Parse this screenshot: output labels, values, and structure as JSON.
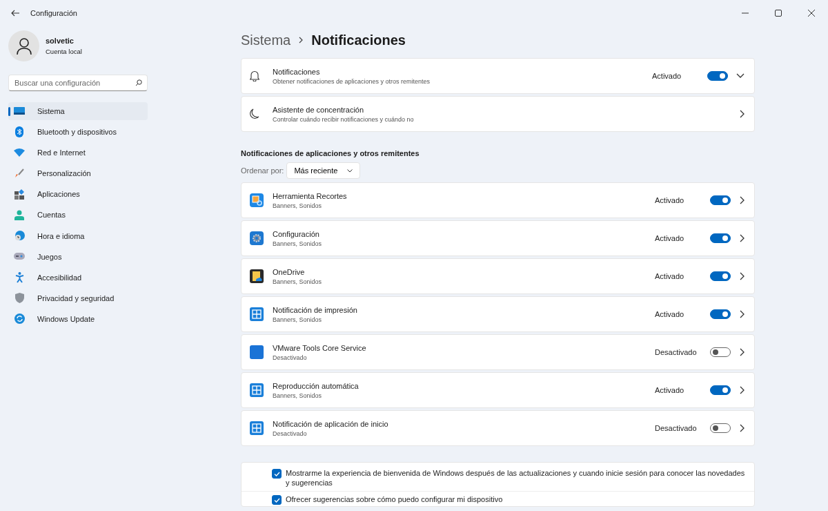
{
  "window": {
    "title": "Configuración"
  },
  "user": {
    "name": "solvetic",
    "account": "Cuenta local"
  },
  "search": {
    "placeholder": "Buscar una configuración"
  },
  "sidebar": {
    "items": [
      {
        "label": "Sistema",
        "kind": "system",
        "selected": true
      },
      {
        "label": "Bluetooth y dispositivos",
        "kind": "bluetooth",
        "selected": false
      },
      {
        "label": "Red e Internet",
        "kind": "network",
        "selected": false
      },
      {
        "label": "Personalización",
        "kind": "brush",
        "selected": false
      },
      {
        "label": "Aplicaciones",
        "kind": "apps",
        "selected": false
      },
      {
        "label": "Cuentas",
        "kind": "accounts",
        "selected": false
      },
      {
        "label": "Hora e idioma",
        "kind": "time",
        "selected": false
      },
      {
        "label": "Juegos",
        "kind": "games",
        "selected": false
      },
      {
        "label": "Accesibilidad",
        "kind": "accessibility",
        "selected": false
      },
      {
        "label": "Privacidad y seguridad",
        "kind": "privacy",
        "selected": false
      },
      {
        "label": "Windows Update",
        "kind": "update",
        "selected": false
      }
    ]
  },
  "breadcrumb": {
    "parent": "Sistema",
    "current": "Notificaciones"
  },
  "cards": [
    {
      "kind": "toggle",
      "title": "Notificaciones",
      "subtitle": "Obtener notificaciones de aplicaciones y otros remitentes",
      "state_label": "Activado",
      "on": true,
      "expanded": false
    },
    {
      "kind": "link",
      "title": "Asistente de concentración",
      "subtitle": "Controlar cuándo recibir notificaciones y cuándo no"
    }
  ],
  "section_title": "Notificaciones de aplicaciones y otros remitentes",
  "sort": {
    "label": "Ordenar por:",
    "value": "Más reciente"
  },
  "apps": [
    {
      "name": "Herramienta Recortes",
      "detail": "Banners, Sonidos",
      "state_label": "Activado",
      "on": true,
      "kind": "snip"
    },
    {
      "name": "Configuración",
      "detail": "Banners, Sonidos",
      "state_label": "Activado",
      "on": true,
      "kind": "gear"
    },
    {
      "name": "OneDrive",
      "detail": "Banners, Sonidos",
      "state_label": "Activado",
      "on": true,
      "kind": "folder"
    },
    {
      "name": "Notificación de impresión",
      "detail": "Banners, Sonidos",
      "state_label": "Activado",
      "on": true,
      "kind": "tile"
    },
    {
      "name": "VMware Tools Core Service",
      "detail": "Desactivado",
      "state_label": "Desactivado",
      "on": false,
      "kind": "blank"
    },
    {
      "name": "Reproducción automática",
      "detail": "Banners, Sonidos",
      "state_label": "Activado",
      "on": true,
      "kind": "tile"
    },
    {
      "name": "Notificación de aplicación de inicio",
      "detail": "Desactivado",
      "state_label": "Desactivado",
      "on": false,
      "kind": "tile"
    }
  ],
  "checks": [
    {
      "label": "Mostrarme la experiencia de bienvenida de Windows después de las actualizaciones y cuando inicie sesión para conocer las novedades y sugerencias",
      "checked": true
    },
    {
      "label": "Ofrecer sugerencias sobre cómo puedo configurar mi dispositivo",
      "checked": true
    }
  ]
}
